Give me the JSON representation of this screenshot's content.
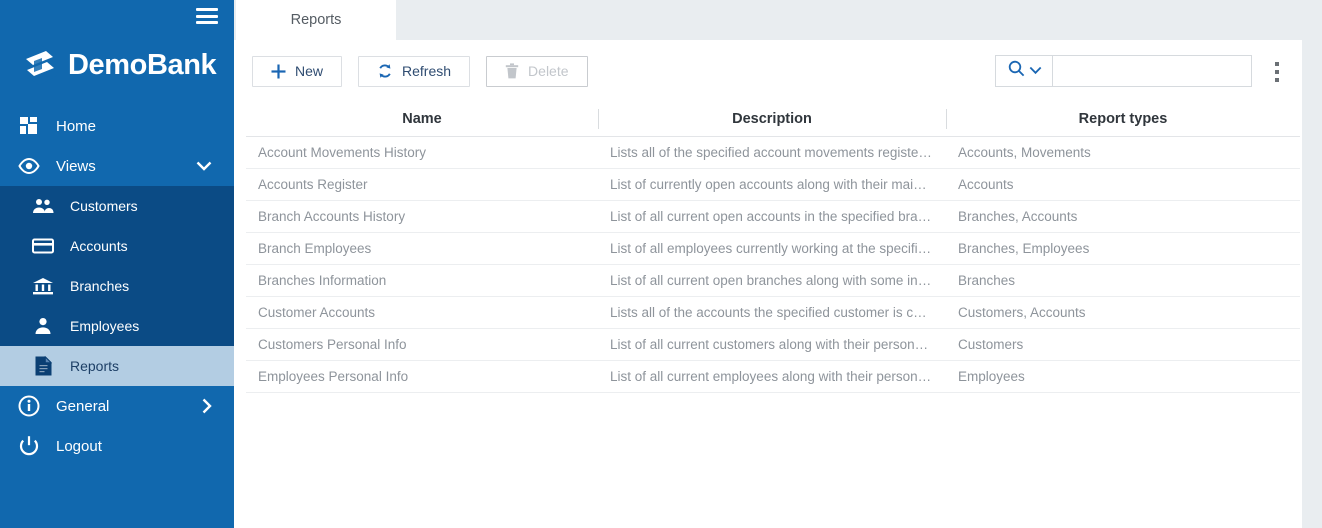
{
  "sidebar": {
    "brand": "DemoBank",
    "menu_icon": "hamburger-icon",
    "items": [
      {
        "label": "Home",
        "icon": "dashboard-icon",
        "level": 1,
        "active": false
      },
      {
        "label": "Views",
        "icon": "eye-icon",
        "level": 1,
        "active": false,
        "chevron": "chevron-down-icon"
      },
      {
        "label": "Customers",
        "icon": "people-icon",
        "level": 2,
        "active": false
      },
      {
        "label": "Accounts",
        "icon": "card-icon",
        "level": 2,
        "active": false
      },
      {
        "label": "Branches",
        "icon": "bank-icon",
        "level": 2,
        "active": false
      },
      {
        "label": "Employees",
        "icon": "person-icon",
        "level": 2,
        "active": false
      },
      {
        "label": "Reports",
        "icon": "document-icon",
        "level": 2,
        "active": true
      },
      {
        "label": "General",
        "icon": "info-icon",
        "level": 1,
        "active": false,
        "chevron": "chevron-right-icon"
      },
      {
        "label": "Logout",
        "icon": "power-icon",
        "level": 1,
        "active": false
      }
    ]
  },
  "tabs": [
    {
      "label": "Reports",
      "active": true
    }
  ],
  "toolbar": {
    "new_label": "New",
    "refresh_label": "Refresh",
    "delete_label": "Delete",
    "new_icon": "plus-icon",
    "refresh_icon": "refresh-icon",
    "delete_icon": "trash-icon",
    "delete_disabled": true,
    "search_icon": "search-icon",
    "search_dropdown_icon": "chevron-down-icon",
    "search_value": "",
    "search_placeholder": "",
    "kebab_icon": "more-vertical-icon"
  },
  "table": {
    "columns": [
      "Name",
      "Description",
      "Report types"
    ],
    "rows": [
      {
        "name": "Account Movements History",
        "description": "Lists all of the specified account movements register…",
        "types": "Accounts, Movements"
      },
      {
        "name": "Accounts Register",
        "description": "List of currently open accounts along with their main…",
        "types": "Accounts"
      },
      {
        "name": "Branch Accounts History",
        "description": "List of all current open accounts in the specified bra…",
        "types": "Branches, Accounts"
      },
      {
        "name": "Branch Employees",
        "description": "List of all employees currently working at the specifie…",
        "types": "Branches, Employees"
      },
      {
        "name": "Branches Information",
        "description": "List of all current open branches along with some inf…",
        "types": "Branches"
      },
      {
        "name": "Customer Accounts",
        "description": "Lists all of the accounts the specified customer is cu…",
        "types": "Customers, Accounts"
      },
      {
        "name": "Customers Personal Info",
        "description": "List of all current customers along with their persona…",
        "types": "Customers"
      },
      {
        "name": "Employees Personal Info",
        "description": "List of all current employees along with their person…",
        "types": "Employees"
      }
    ]
  },
  "colors": {
    "sidebar": "#1168ae",
    "submenu": "#0b4b85",
    "active_item": "#b3cde3",
    "accent": "#1168ae",
    "page_bg": "#e9edf0"
  }
}
